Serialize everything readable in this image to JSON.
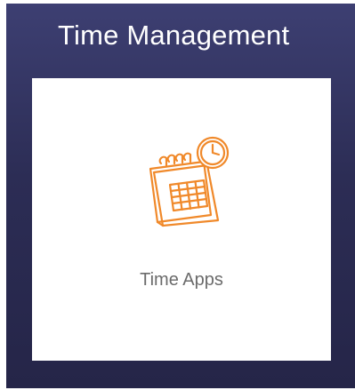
{
  "section": {
    "title": "Time Management"
  },
  "tiles": [
    {
      "label": "Time Apps",
      "icon": "calendar-clock-icon"
    }
  ],
  "colors": {
    "panel_background": "#2c2d55",
    "tile_background": "#ffffff",
    "icon_accent": "#f0892a",
    "label_text": "#6b6b6b",
    "title_text": "#ffffff"
  }
}
